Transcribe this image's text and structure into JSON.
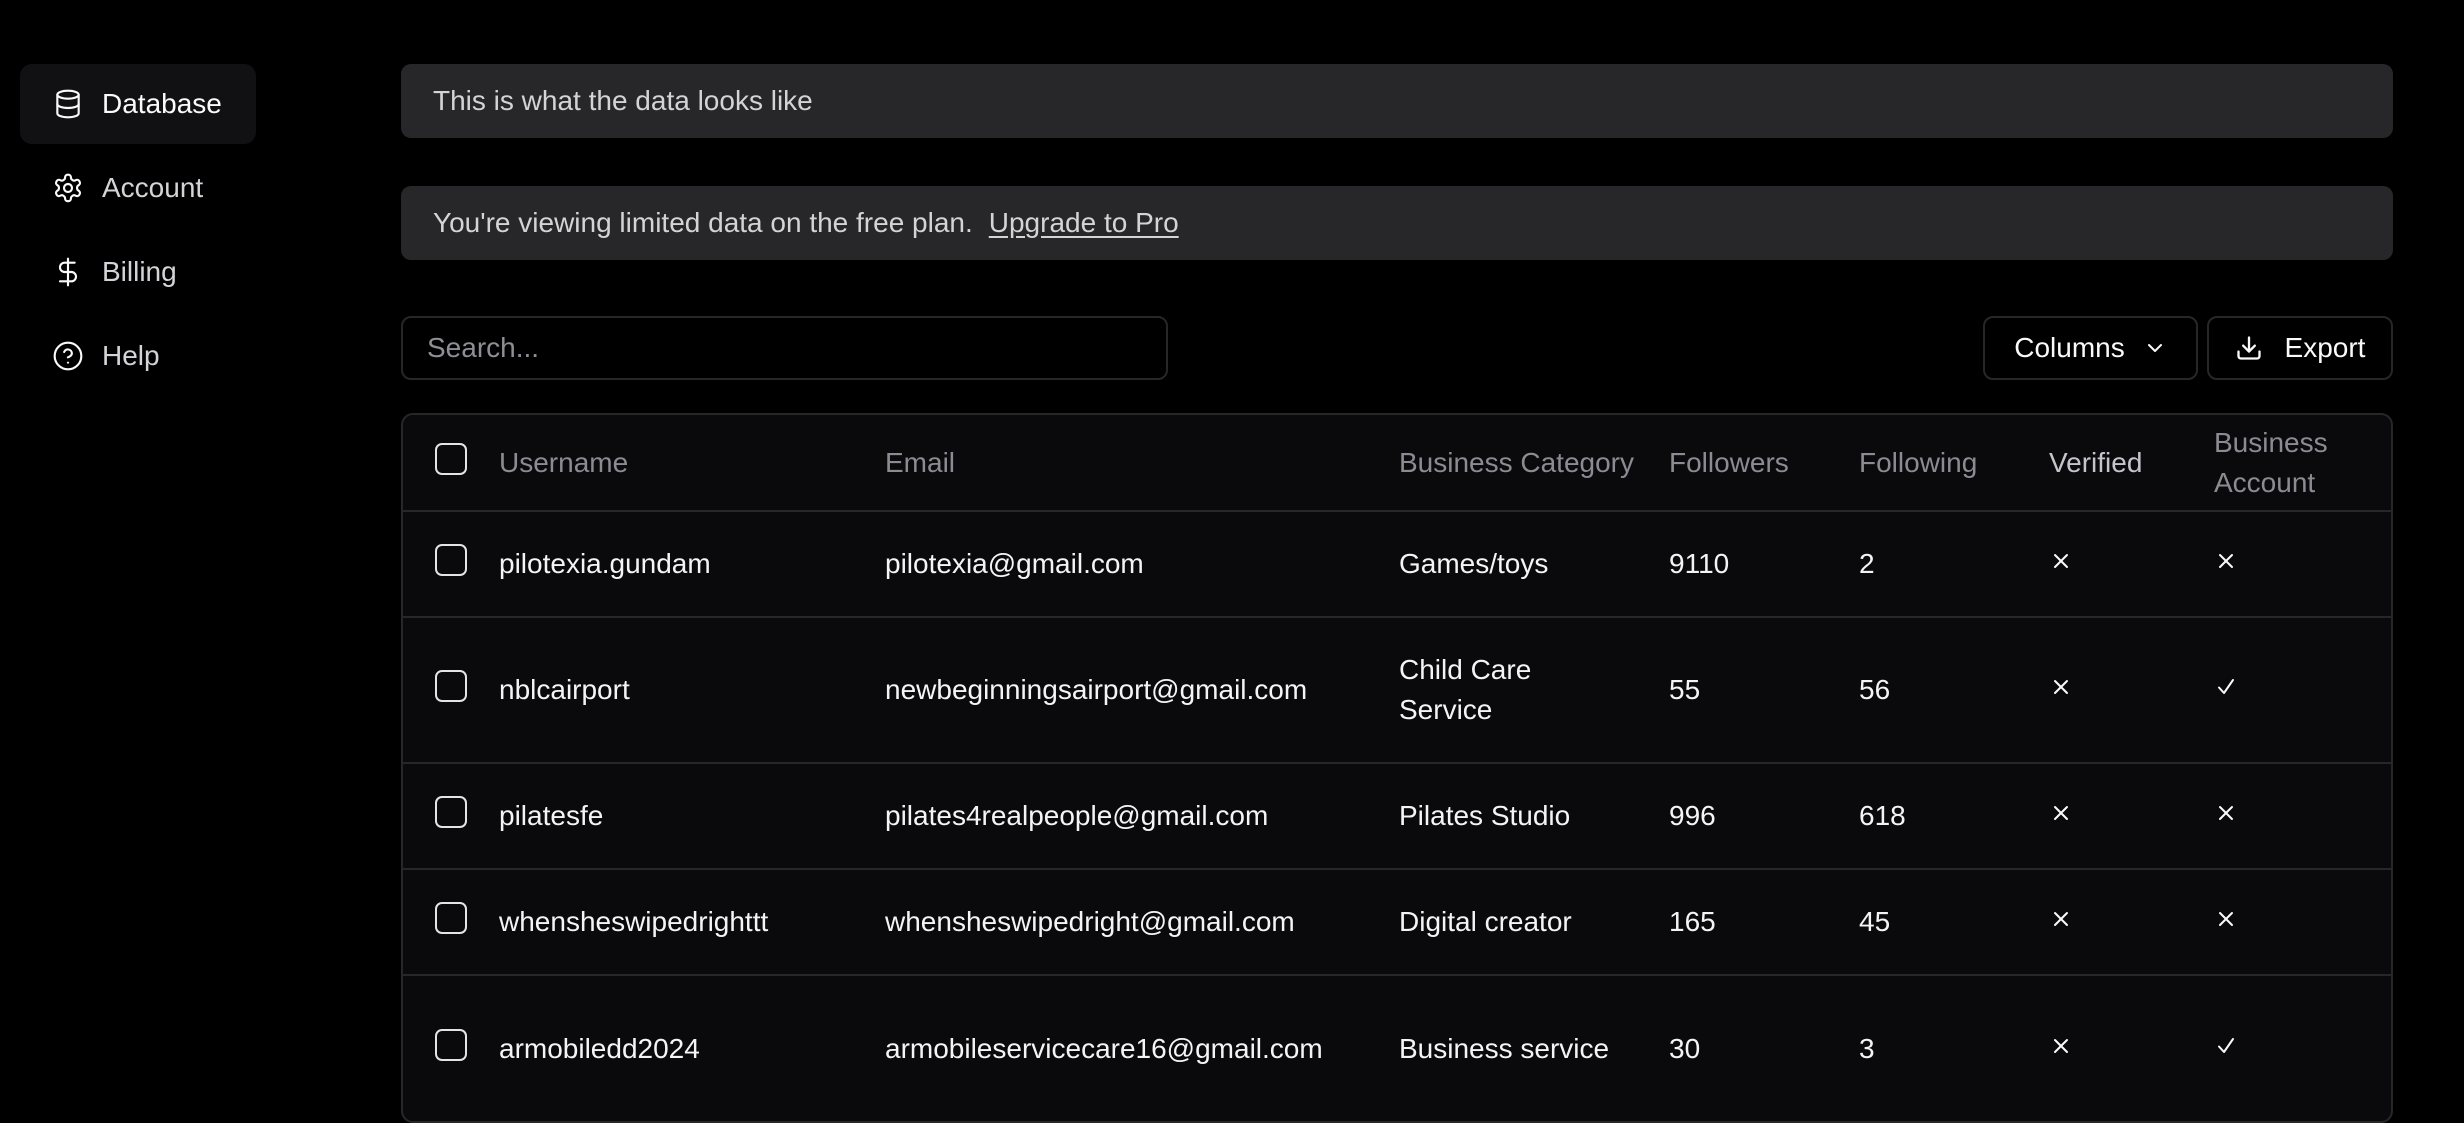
{
  "sidebar": {
    "items": [
      {
        "label": "Database",
        "icon": "database-icon",
        "active": true
      },
      {
        "label": "Account",
        "icon": "gear-icon",
        "active": false
      },
      {
        "label": "Billing",
        "icon": "dollar-icon",
        "active": false
      },
      {
        "label": "Help",
        "icon": "help-circle-icon",
        "active": false
      }
    ]
  },
  "banners": {
    "info": "This is what the data looks like",
    "plan_notice": "You're viewing limited data on the free plan.",
    "upgrade_link": "Upgrade to Pro"
  },
  "toolbar": {
    "search_placeholder": "Search...",
    "search_value": "",
    "columns_label": "Columns",
    "export_label": "Export"
  },
  "table": {
    "columns": {
      "username": "Username",
      "email": "Email",
      "category": "Business Category",
      "followers": "Followers",
      "following": "Following",
      "verified": "Verified",
      "business_account": "Business Account"
    },
    "rows": [
      {
        "username": "pilotexia.gundam",
        "email": "pilotexia@gmail.com",
        "category": "Games/toys",
        "followers": "9110",
        "following": "2",
        "verified": false,
        "business_account": false
      },
      {
        "username": "nblcairport",
        "email": "newbeginningsairport@gmail.com",
        "category": "Child Care Service",
        "followers": "55",
        "following": "56",
        "verified": false,
        "business_account": true
      },
      {
        "username": "pilatesfe",
        "email": "pilates4realpeople@gmail.com",
        "category": "Pilates Studio",
        "followers": "996",
        "following": "618",
        "verified": false,
        "business_account": false
      },
      {
        "username": "whensheswipedrighttt",
        "email": "whensheswipedright@gmail.com",
        "category": "Digital creator",
        "followers": "165",
        "following": "45",
        "verified": false,
        "business_account": false
      },
      {
        "username": "armobiledd2024",
        "email": "armobileservicecare16@gmail.com",
        "category": "Business service",
        "followers": "30",
        "following": "3",
        "verified": false,
        "business_account": true
      }
    ]
  },
  "colors": {
    "background": "#000000",
    "banner": "#27272a",
    "table_bg": "#0a0a0c",
    "border": "#27272a",
    "header_text": "#8b8b93",
    "text": "#f4f4f5"
  }
}
